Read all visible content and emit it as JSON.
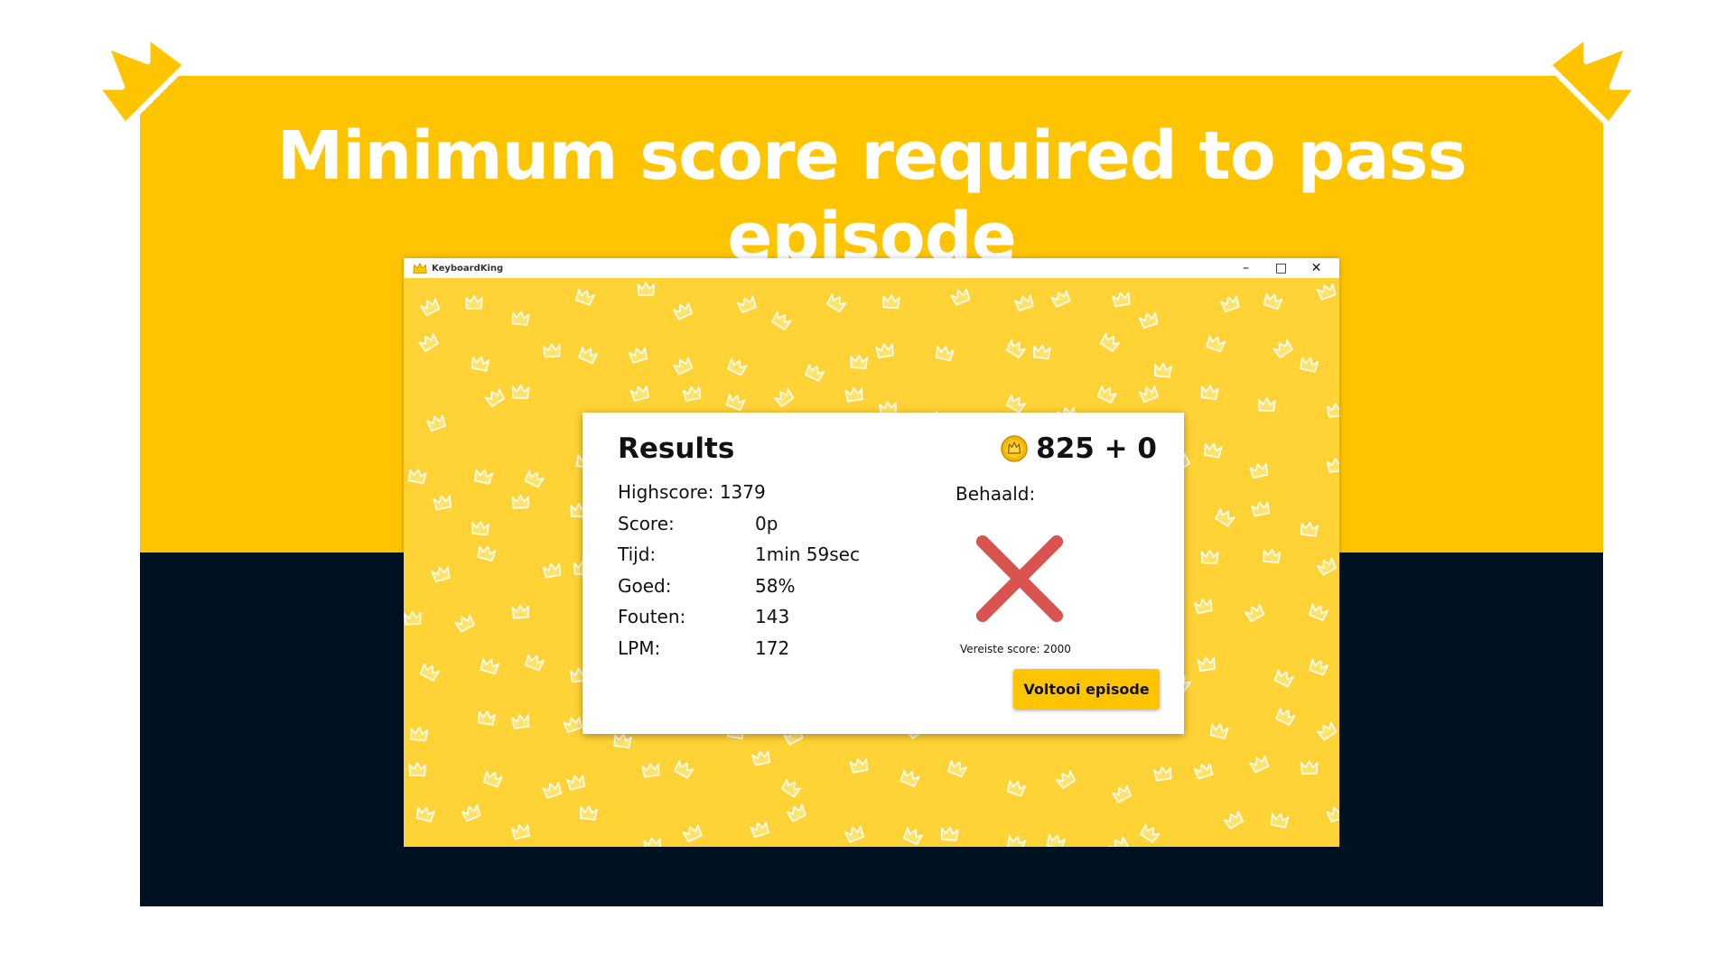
{
  "slide": {
    "headline": "Minimum score required to pass episode"
  },
  "window": {
    "title": "KeyboardKing",
    "controls": {
      "minimize": "–",
      "maximize": "□",
      "close": "✕"
    }
  },
  "results": {
    "title": "Results",
    "highscore_label": "Highscore:",
    "highscore_value": "1379",
    "coins": "825 + 0",
    "stats": [
      {
        "label": "Score:",
        "value": "0p"
      },
      {
        "label": "Tijd:",
        "value": "1min 59sec"
      },
      {
        "label": "Goed:",
        "value": "58%"
      },
      {
        "label": "Fouten:",
        "value": "143"
      },
      {
        "label": "LPM:",
        "value": "172"
      }
    ],
    "achieved_label": "Behaald:",
    "achieved_icon": "red-cross-icon",
    "required_score": "Vereiste score: 2000",
    "finish_button": "Voltooi episode"
  },
  "colors": {
    "brand_yellow": "#FFC400",
    "pattern_yellow": "#FFD235",
    "navy": "#011323",
    "fail_red": "#D9534F"
  }
}
